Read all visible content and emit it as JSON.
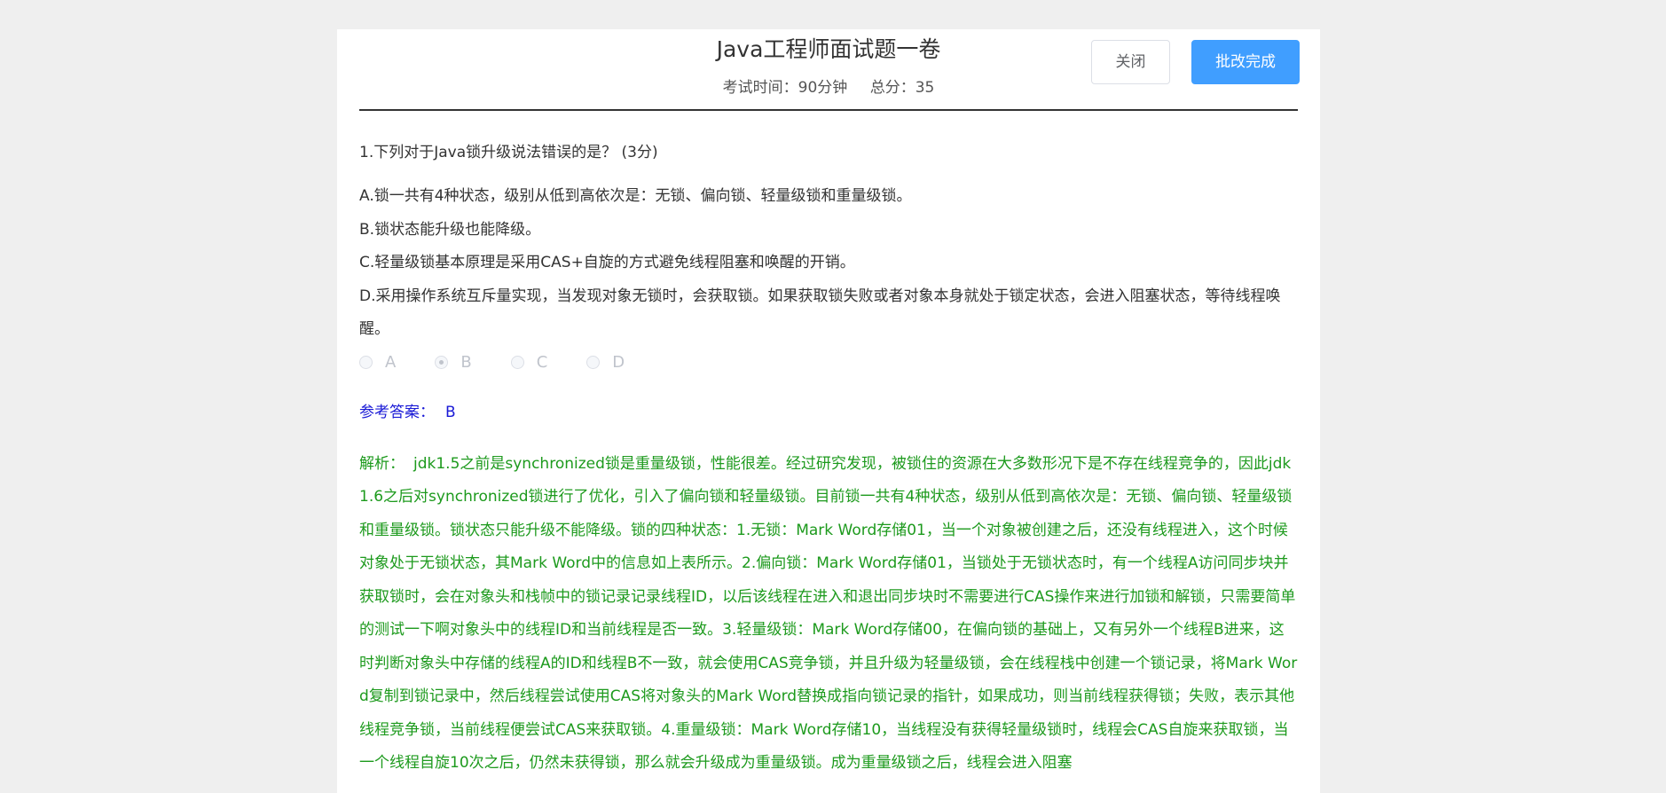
{
  "header": {
    "title": "Java工程师面试题一卷",
    "duration": "考试时间：90分钟",
    "total_score": "总分：35",
    "close_label": "关闭",
    "finish_label": "批改完成"
  },
  "question": {
    "title": "1.下列对于Java锁升级说法错误的是？ (3分)",
    "options": [
      "A.锁一共有4种状态，级别从低到高依次是：无锁、偏向锁、轻量级锁和重量级锁。",
      "B.锁状态能升级也能降级。",
      "C.轻量级锁基本原理是采用CAS+自旋的方式避免线程阻塞和唤醒的开销。",
      "D.采用操作系统互斥量实现，当发现对象无锁时，会获取锁。如果获取锁失败或者对象本身就处于锁定状态，会进入阻塞状态，等待线程唤醒。"
    ],
    "radios": [
      {
        "label": "A",
        "checked": false
      },
      {
        "label": "B",
        "checked": true
      },
      {
        "label": "C",
        "checked": false
      },
      {
        "label": "D",
        "checked": false
      }
    ],
    "answer_label": "参考答案：",
    "answer_value": "B",
    "analysis_label": "解析：",
    "analysis_text": "jdk1.5之前是synchronized锁是重量级锁，性能很差。经过研究发现，被锁住的资源在大多数形况下是不存在线程竞争的，因此jdk1.6之后对synchronized锁进行了优化，引入了偏向锁和轻量级锁。目前锁一共有4种状态，级别从低到高依次是：无锁、偏向锁、轻量级锁和重量级锁。锁状态只能升级不能降级。锁的四种状态：1.无锁：Mark Word存储01，当一个对象被创建之后，还没有线程进入，这个时候对象处于无锁状态，其Mark Word中的信息如上表所示。2.偏向锁：Mark Word存储01，当锁处于无锁状态时，有一个线程A访问同步块并获取锁时，会在对象头和栈帧中的锁记录记录线程ID，以后该线程在进入和退出同步块时不需要进行CAS操作来进行加锁和解锁，只需要简单的测试一下啊对象头中的线程ID和当前线程是否一致。3.轻量级锁：Mark Word存储00，在偏向锁的基础上，又有另外一个线程B进来，这时判断对象头中存储的线程A的ID和线程B不一致，就会使用CAS竞争锁，并且升级为轻量级锁，会在线程栈中创建一个锁记录，将Mark Word复制到锁记录中，然后线程尝试使用CAS将对象头的Mark Word替换成指向锁记录的指针，如果成功，则当前线程获得锁；失败，表示其他线程竞争锁，当前线程便尝试CAS来获取锁。4.重量级锁：Mark Word存储10，当线程没有获得轻量级锁时，线程会CAS自旋来获取锁，当一个线程自旋10次之后，仍然未获得锁，那么就会升级成为重量级锁。成为重量级锁之后，线程会进入阻塞"
  }
}
